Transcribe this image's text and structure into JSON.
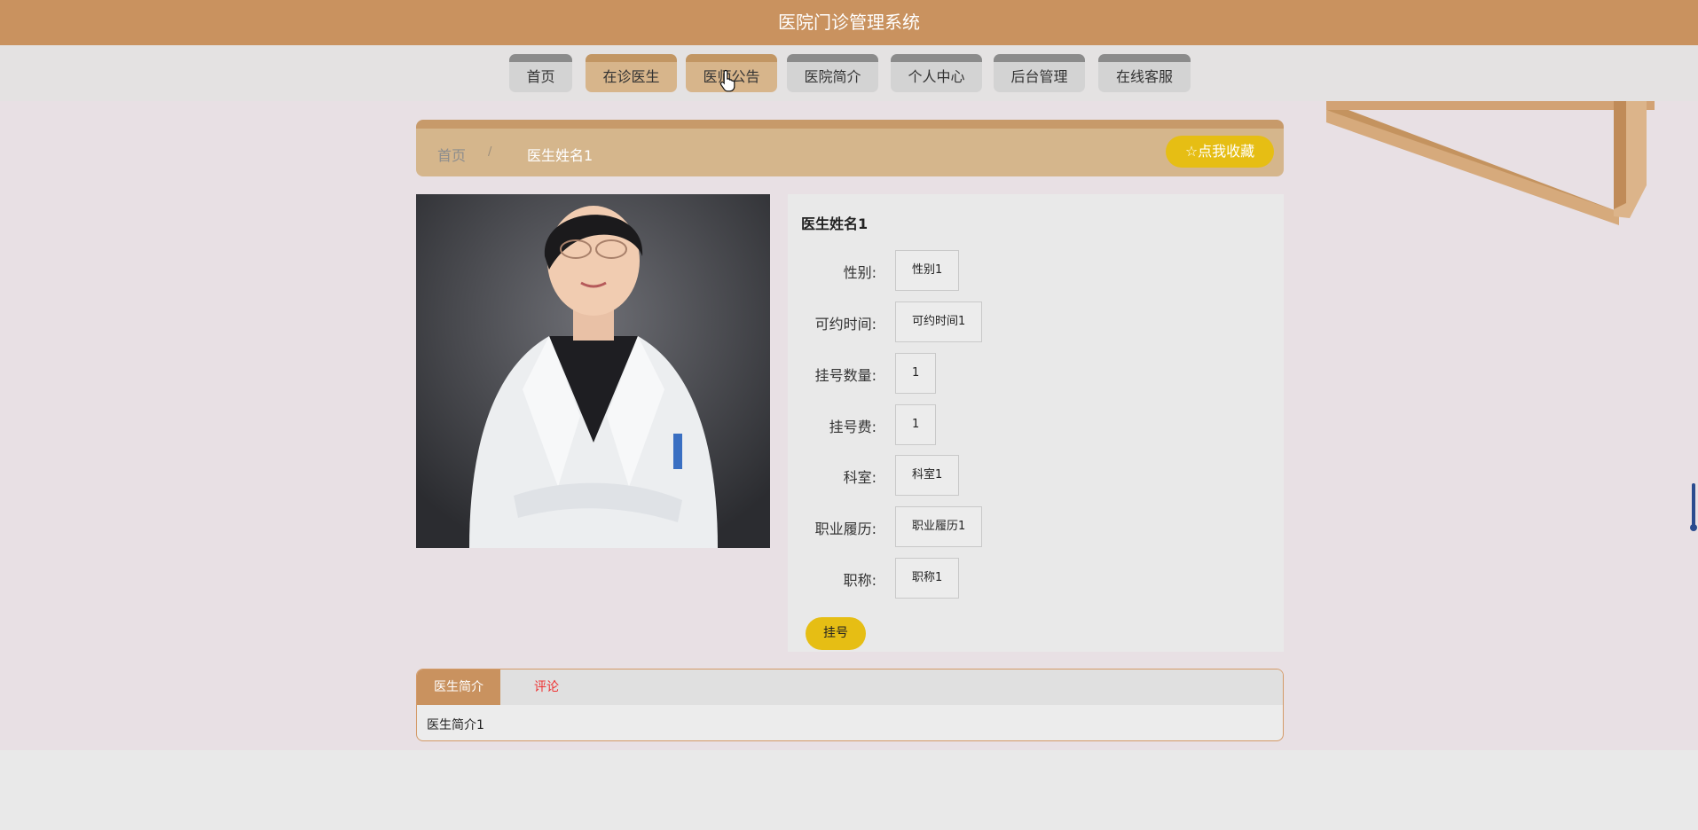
{
  "header": {
    "title": "医院门诊管理系统"
  },
  "nav": {
    "items": [
      "首页",
      "在诊医生",
      "医师公告",
      "医院简介",
      "个人中心",
      "后台管理",
      "在线客服"
    ]
  },
  "breadcrumb": {
    "home": "首页",
    "separator": "/",
    "current": "医生姓名1",
    "favorite_label": "☆点我收藏"
  },
  "doctor": {
    "name": "医生姓名1",
    "fields": [
      {
        "label": "性别:",
        "value": "性别1"
      },
      {
        "label": "可约时间:",
        "value": "可约时间1"
      },
      {
        "label": "挂号数量:",
        "value": "1"
      },
      {
        "label": "挂号费:",
        "value": "1"
      },
      {
        "label": "科室:",
        "value": "科室1"
      },
      {
        "label": "职业履历:",
        "value": "职业履历1"
      },
      {
        "label": "职称:",
        "value": "职称1"
      }
    ],
    "register_label": "挂号"
  },
  "tabs": {
    "intro_label": "医生简介",
    "comment_label": "评论",
    "intro_content": "医生简介1"
  },
  "colors": {
    "brand": "#c9925f",
    "accent_yellow": "#e6be14",
    "comment_tab": "#e33333"
  }
}
